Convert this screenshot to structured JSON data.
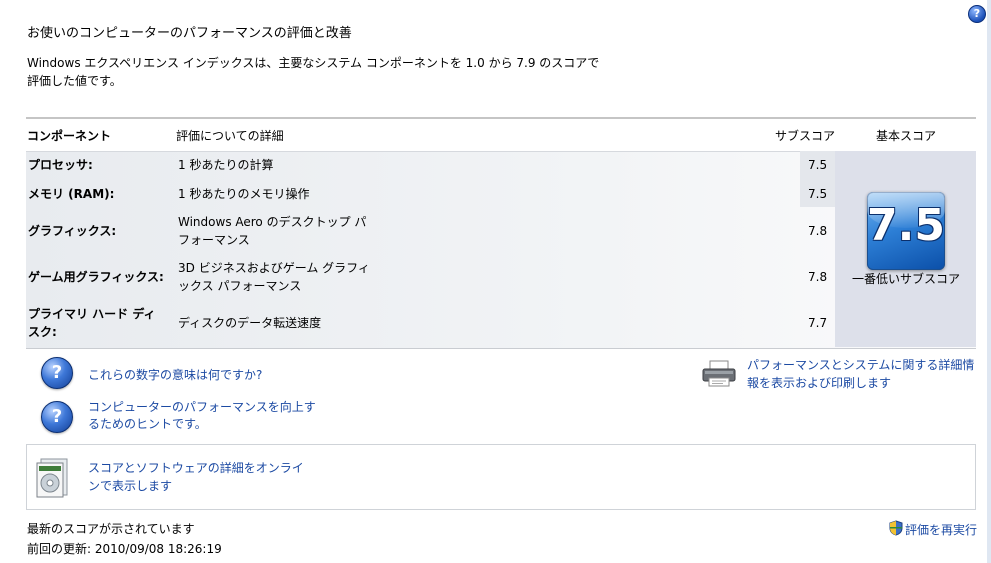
{
  "header": {
    "title": "お使いのコンピューターのパフォーマンスの評価と改善",
    "description_line1": "Windows エクスペリエンス インデックスは、主要なシステム コンポーネントを 1.0 から 7.9 のスコアで",
    "description_line2": "評価した値です。",
    "help_icon": "question-icon"
  },
  "table": {
    "columns": {
      "component": "コンポーネント",
      "details": "評価についての詳細",
      "subscore": "サブスコア",
      "basescore": "基本スコア"
    },
    "rows": [
      {
        "component": "プロセッサ:",
        "detail": "1 秒あたりの計算",
        "subscore": "7.5"
      },
      {
        "component": "メモリ (RAM):",
        "detail": "1 秒あたりのメモリ操作",
        "subscore": "7.5"
      },
      {
        "component": "グラフィックス:",
        "detail": "Windows Aero のデスクトップ パフォーマンス",
        "subscore": "7.8"
      },
      {
        "component": "ゲーム用グラフィックス:",
        "detail": "3D ビジネスおよびゲーム グラフィックス パフォーマンス",
        "subscore": "7.8"
      },
      {
        "component": "プライマリ ハード ディスク:",
        "detail": "ディスクのデータ転送速度",
        "subscore": "7.7"
      }
    ],
    "base_score": "7.5",
    "base_score_caption": "一番低いサブスコア"
  },
  "links": {
    "what_numbers_mean": "これらの数字の意味は何ですか?",
    "tips": "コンピューターのパフォーマンスを向上するためのヒントです。",
    "print_details": "パフォーマンスとシステムに関する詳細情報を表示および印刷します",
    "online_details": "スコアとソフトウェアの詳細をオンラインで表示します",
    "rerun": "評価を再実行"
  },
  "footer": {
    "status": "最新のスコアが示されています",
    "last_update": "前回の更新: 2010/09/08 18:26:19"
  },
  "icons": {
    "help": "question-icon",
    "printer": "printer-icon",
    "online": "software-box-icon",
    "shield": "uac-shield-icon"
  },
  "colors": {
    "link": "#1c4aa3",
    "score_tile": "#2d7fd6"
  }
}
